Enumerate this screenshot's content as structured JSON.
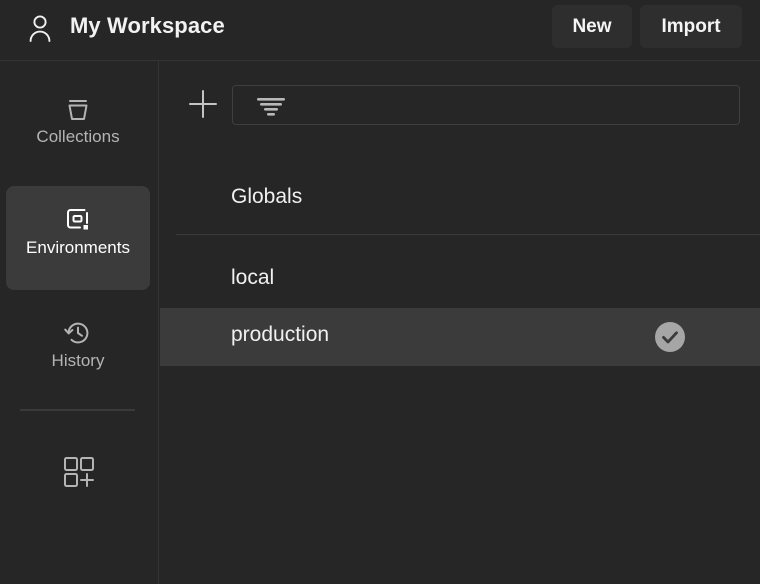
{
  "header": {
    "user_icon": "user-icon",
    "title": "My Workspace",
    "new_label": "New",
    "import_label": "Import"
  },
  "sidebar": {
    "items": [
      {
        "label": "Collections",
        "icon": "collections-bucket-icon",
        "selected": false
      },
      {
        "label": "Environments",
        "icon": "environments-icon",
        "selected": true
      },
      {
        "label": "History",
        "icon": "history-clock-icon",
        "selected": false
      }
    ],
    "add_apps_icon": "add-apps-grid-icon"
  },
  "main": {
    "add_button_icon": "plus-icon",
    "filter": {
      "icon": "filter-icon",
      "value": "",
      "placeholder": ""
    },
    "rows": [
      {
        "label": "Globals",
        "selected": false,
        "active": false
      },
      {
        "label": "local",
        "selected": false,
        "active": false
      },
      {
        "label": "production",
        "selected": true,
        "active": true,
        "active_icon": "check-circle-icon"
      }
    ]
  },
  "colors": {
    "background": "#262626",
    "selected_row": "#3b3b3b",
    "button": "#2e2e2e",
    "divider": "#3a3a3a",
    "text_primary": "#f0f0f0",
    "text_muted": "#b4b4b4",
    "check_badge": "#a6a6a6"
  }
}
